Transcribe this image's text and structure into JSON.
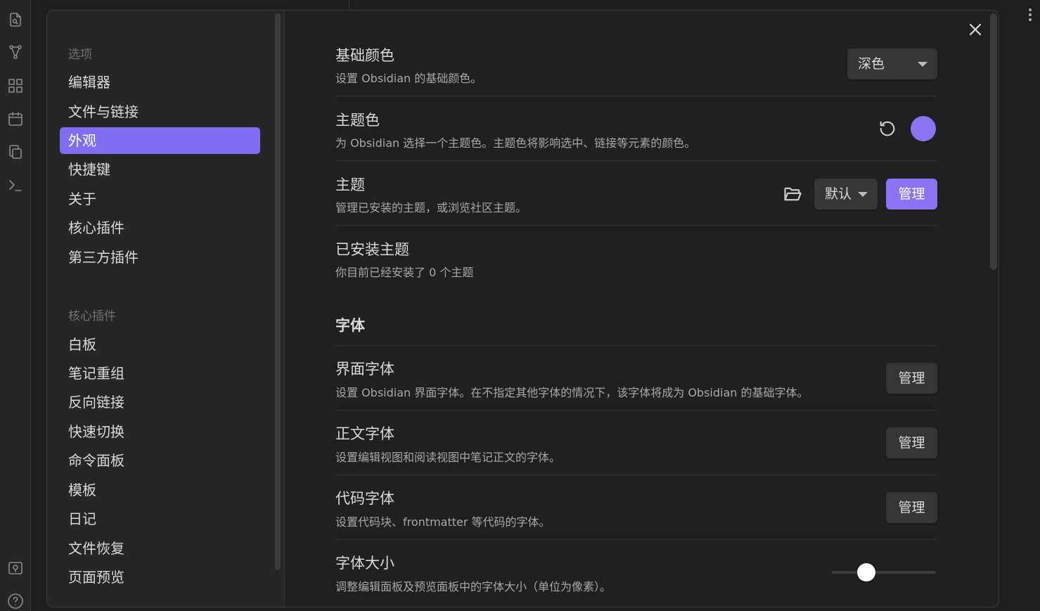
{
  "ribbon": {
    "icons": [
      "file-search-icon",
      "graph-icon",
      "grid-icon",
      "calendar-icon",
      "copy-icon",
      "terminal-icon",
      "vault-icon",
      "help-icon"
    ]
  },
  "sidebar": {
    "section_options": "选项",
    "options": [
      {
        "label": "编辑器",
        "active": false
      },
      {
        "label": "文件与链接",
        "active": false
      },
      {
        "label": "外观",
        "active": true
      },
      {
        "label": "快捷键",
        "active": false
      },
      {
        "label": "关于",
        "active": false
      },
      {
        "label": "核心插件",
        "active": false
      },
      {
        "label": "第三方插件",
        "active": false
      }
    ],
    "section_core_plugins": "核心插件",
    "core_plugins": [
      {
        "label": "白板"
      },
      {
        "label": "笔记重组"
      },
      {
        "label": "反向链接"
      },
      {
        "label": "快速切换"
      },
      {
        "label": "命令面板"
      },
      {
        "label": "模板"
      },
      {
        "label": "日记"
      },
      {
        "label": "文件恢复"
      },
      {
        "label": "页面预览"
      }
    ]
  },
  "settings": {
    "base_color": {
      "name": "基础颜色",
      "desc": "设置 Obsidian 的基础颜色。",
      "value": "深色"
    },
    "accent_color": {
      "name": "主题色",
      "desc": "为 Obsidian 选择一个主题色。主题色将影响选中、链接等元素的颜色。",
      "color": "#8b74f4"
    },
    "theme": {
      "name": "主题",
      "desc": "管理已安装的主题，或浏览社区主题。",
      "value": "默认",
      "manage_label": "管理"
    },
    "installed_themes": {
      "name": "已安装主题",
      "desc": "你目前已经安装了 0 个主题"
    },
    "font_heading": "字体",
    "interface_font": {
      "name": "界面字体",
      "desc": "设置 Obsidian 界面字体。在不指定其他字体的情况下，该字体将成为 Obsidian 的基础字体。",
      "manage_label": "管理"
    },
    "text_font": {
      "name": "正文字体",
      "desc": "设置编辑视图和阅读视图中笔记正文的字体。",
      "manage_label": "管理"
    },
    "code_font": {
      "name": "代码字体",
      "desc": "设置代码块、frontmatter 等代码的字体。",
      "manage_label": "管理"
    },
    "font_size": {
      "name": "字体大小",
      "desc": "调整编辑面板及预览面板中的字体大小（单位为像素）。",
      "slider_fraction": 0.33
    }
  }
}
